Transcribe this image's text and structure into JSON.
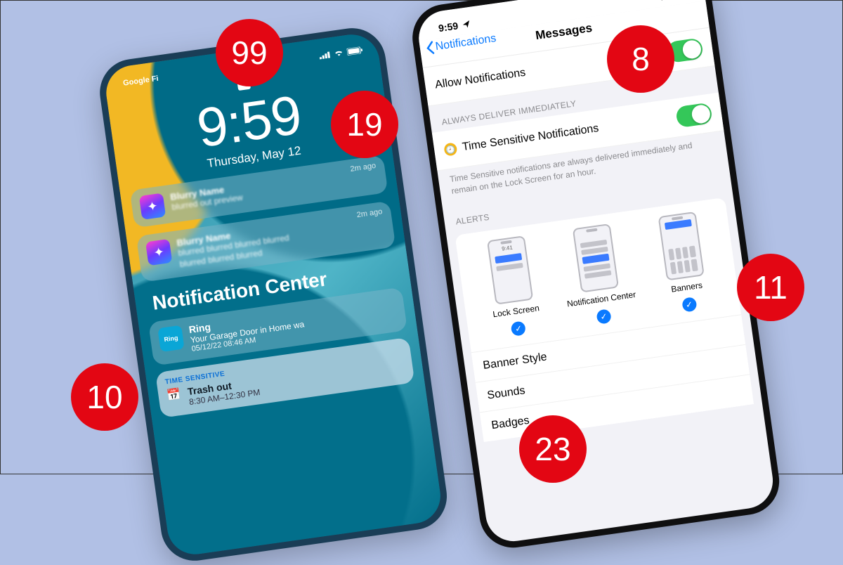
{
  "badges": {
    "b99": "99",
    "b19": "19",
    "b8": "8",
    "b10": "10",
    "b11": "11",
    "b23": "23"
  },
  "phone1": {
    "carrier": "Google Fi",
    "time": "9:59",
    "date": "Thursday, May 12",
    "notif_ago": "2m ago",
    "nc_header": "Notification Center",
    "ring": {
      "app": "Ring",
      "line1": "Ring",
      "line2": "Your Garage Door in Home wa",
      "line3": "05/12/22 08:46 AM"
    },
    "ts": {
      "tag": "TIME SENSITIVE",
      "title": "Trash out",
      "time": "8:30 AM–12:30 PM"
    }
  },
  "phone2": {
    "status_time": "9:59",
    "back_label": "Notifications",
    "title": "Messages",
    "allow": "Allow Notifications",
    "always_header": "ALWAYS DELIVER IMMEDIATELY",
    "ts_label": "Time Sensitive Notifications",
    "ts_footer": "Time Sensitive notifications are always delivered immediately and remain on the Lock Screen for an hour.",
    "alerts_header": "ALERTS",
    "alert_types": {
      "lock": "Lock Screen",
      "nc": "Notification Center",
      "banners": "Banners"
    },
    "mini_time": "9:41",
    "rows": {
      "banner_style": "Banner Style",
      "sounds": "Sounds",
      "badges": "Badges"
    }
  }
}
